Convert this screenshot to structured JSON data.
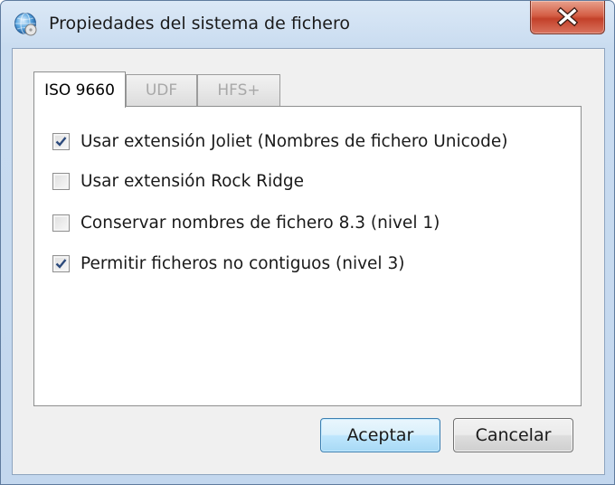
{
  "window": {
    "title": "Propiedades del sistema de fichero",
    "icon": "globe-disc-icon",
    "close_icon": "close-icon"
  },
  "tabs": [
    {
      "label": "ISO 9660",
      "active": true,
      "enabled": true
    },
    {
      "label": "UDF",
      "active": false,
      "enabled": false
    },
    {
      "label": "HFS+",
      "active": false,
      "enabled": false
    }
  ],
  "options": [
    {
      "label": "Usar extensión Joliet (Nombres de fichero Unicode)",
      "checked": true
    },
    {
      "label": "Usar extensión Rock Ridge",
      "checked": false
    },
    {
      "label": "Conservar nombres de fichero 8.3 (nivel 1)",
      "checked": false
    },
    {
      "label": "Permitir ficheros no contiguos (nivel 3)",
      "checked": true
    }
  ],
  "buttons": {
    "accept_label": "Aceptar",
    "cancel_label": "Cancelar"
  },
  "colors": {
    "close_button": "#c3412a",
    "default_button_border": "#3c7fb1",
    "checkmark": "#2c4a7c"
  }
}
